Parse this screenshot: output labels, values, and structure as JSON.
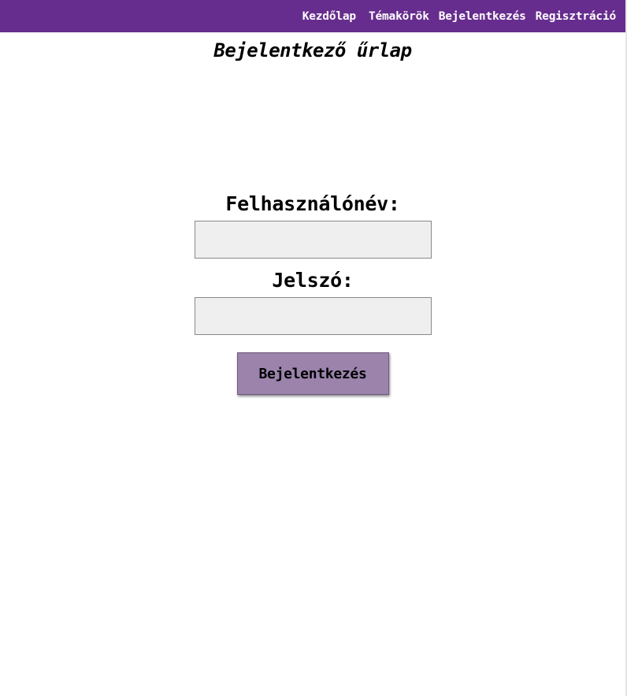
{
  "nav": {
    "items": [
      {
        "label": "Kezdőlap"
      },
      {
        "label": "Témakörök"
      },
      {
        "label": "Bejelentkezés"
      },
      {
        "label": "Regisztráció"
      }
    ]
  },
  "page": {
    "title": "Bejelentkező űrlap"
  },
  "form": {
    "username_label": "Felhasználónév:",
    "username_value": "",
    "password_label": "Jelszó:",
    "password_value": "",
    "submit_label": "Bejelentkezés"
  },
  "colors": {
    "header_bg": "#672d8e",
    "button_bg": "#9b83ac",
    "input_bg": "#efefef"
  }
}
